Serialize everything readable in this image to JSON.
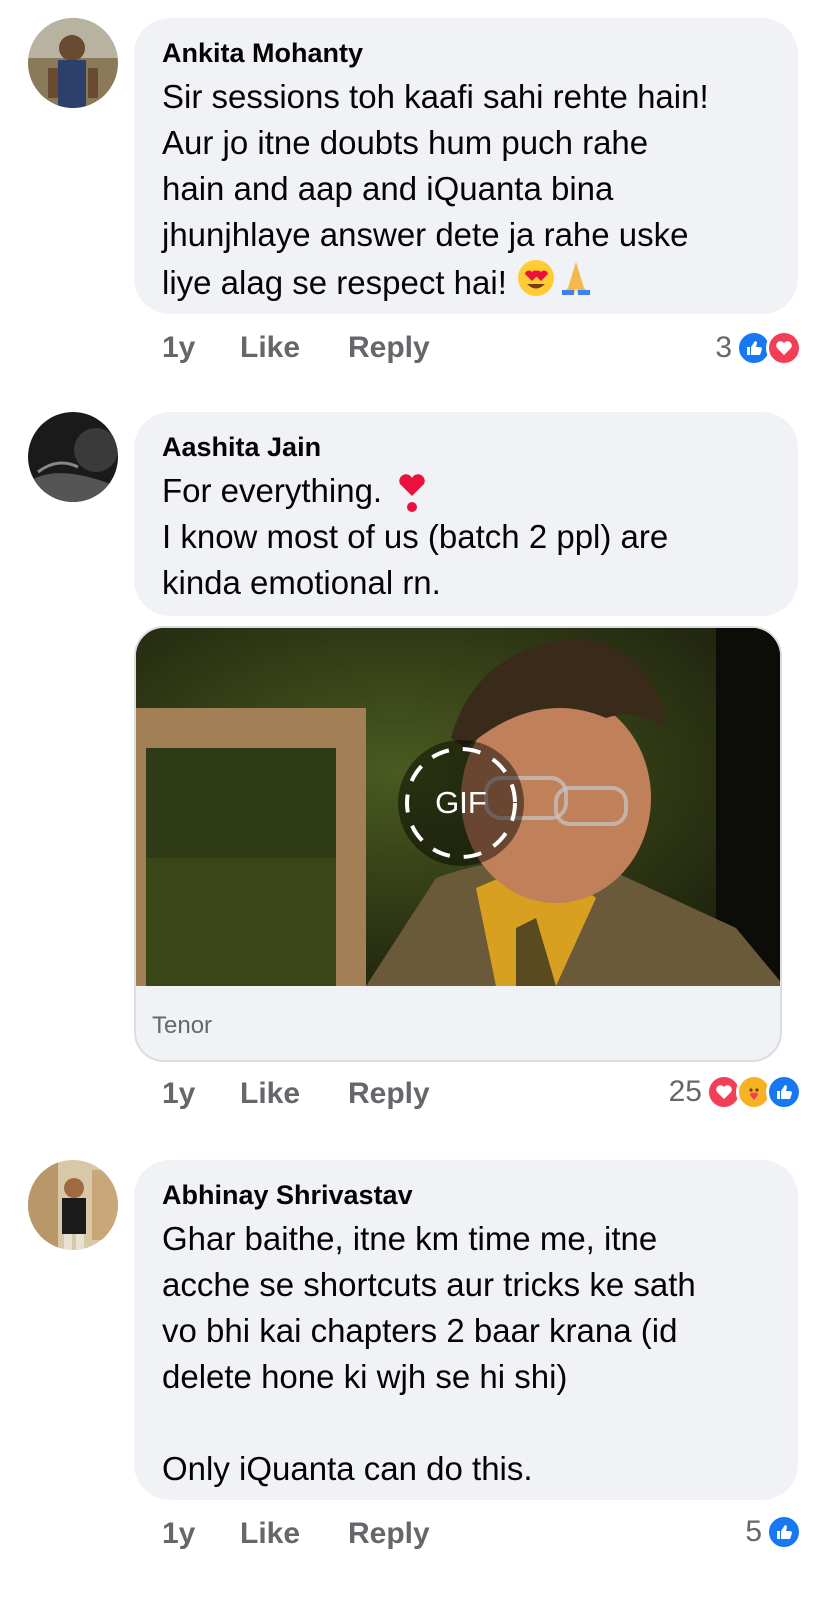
{
  "comments": [
    {
      "name": "Ankita Mohanty",
      "text": "Sir sessions toh kaafi sahi rehte hain!\nAur jo itne doubts hum puch rahe\nhain and aap and iQuanta bina\njhunjhlaye answer dete ja rahe uske\nliye alag se respect hai!",
      "time": "1y",
      "like_label": "Like",
      "reply_label": "Reply",
      "reaction_count": "3",
      "reactions": [
        "like-icon",
        "love-icon"
      ]
    },
    {
      "name": "Aashita Jain",
      "text": "For everything.\nI know most of us (batch 2 ppl) are\nkinda emotional rn.",
      "gif_badge": "GIF",
      "gif_source": "Tenor",
      "time": "1y",
      "like_label": "Like",
      "reply_label": "Reply",
      "reaction_count": "25",
      "reactions": [
        "love-icon",
        "care-icon",
        "like-icon"
      ]
    },
    {
      "name": "Abhinay Shrivastav",
      "text": "Ghar baithe, itne km time me, itne\nacche se shortcuts aur tricks ke sath\nvo bhi kai chapters 2 baar krana (id\ndelete hone ki wjh se hi shi)\n\nOnly iQuanta can do this.",
      "time": "1y",
      "like_label": "Like",
      "reply_label": "Reply",
      "reaction_count": "5",
      "reactions": [
        "like-icon"
      ]
    }
  ],
  "colors": {
    "bubble_bg": "#f0f2f5",
    "meta_text": "#65676b",
    "like_blue": "#1877f2",
    "love_red": "#f33e58"
  }
}
